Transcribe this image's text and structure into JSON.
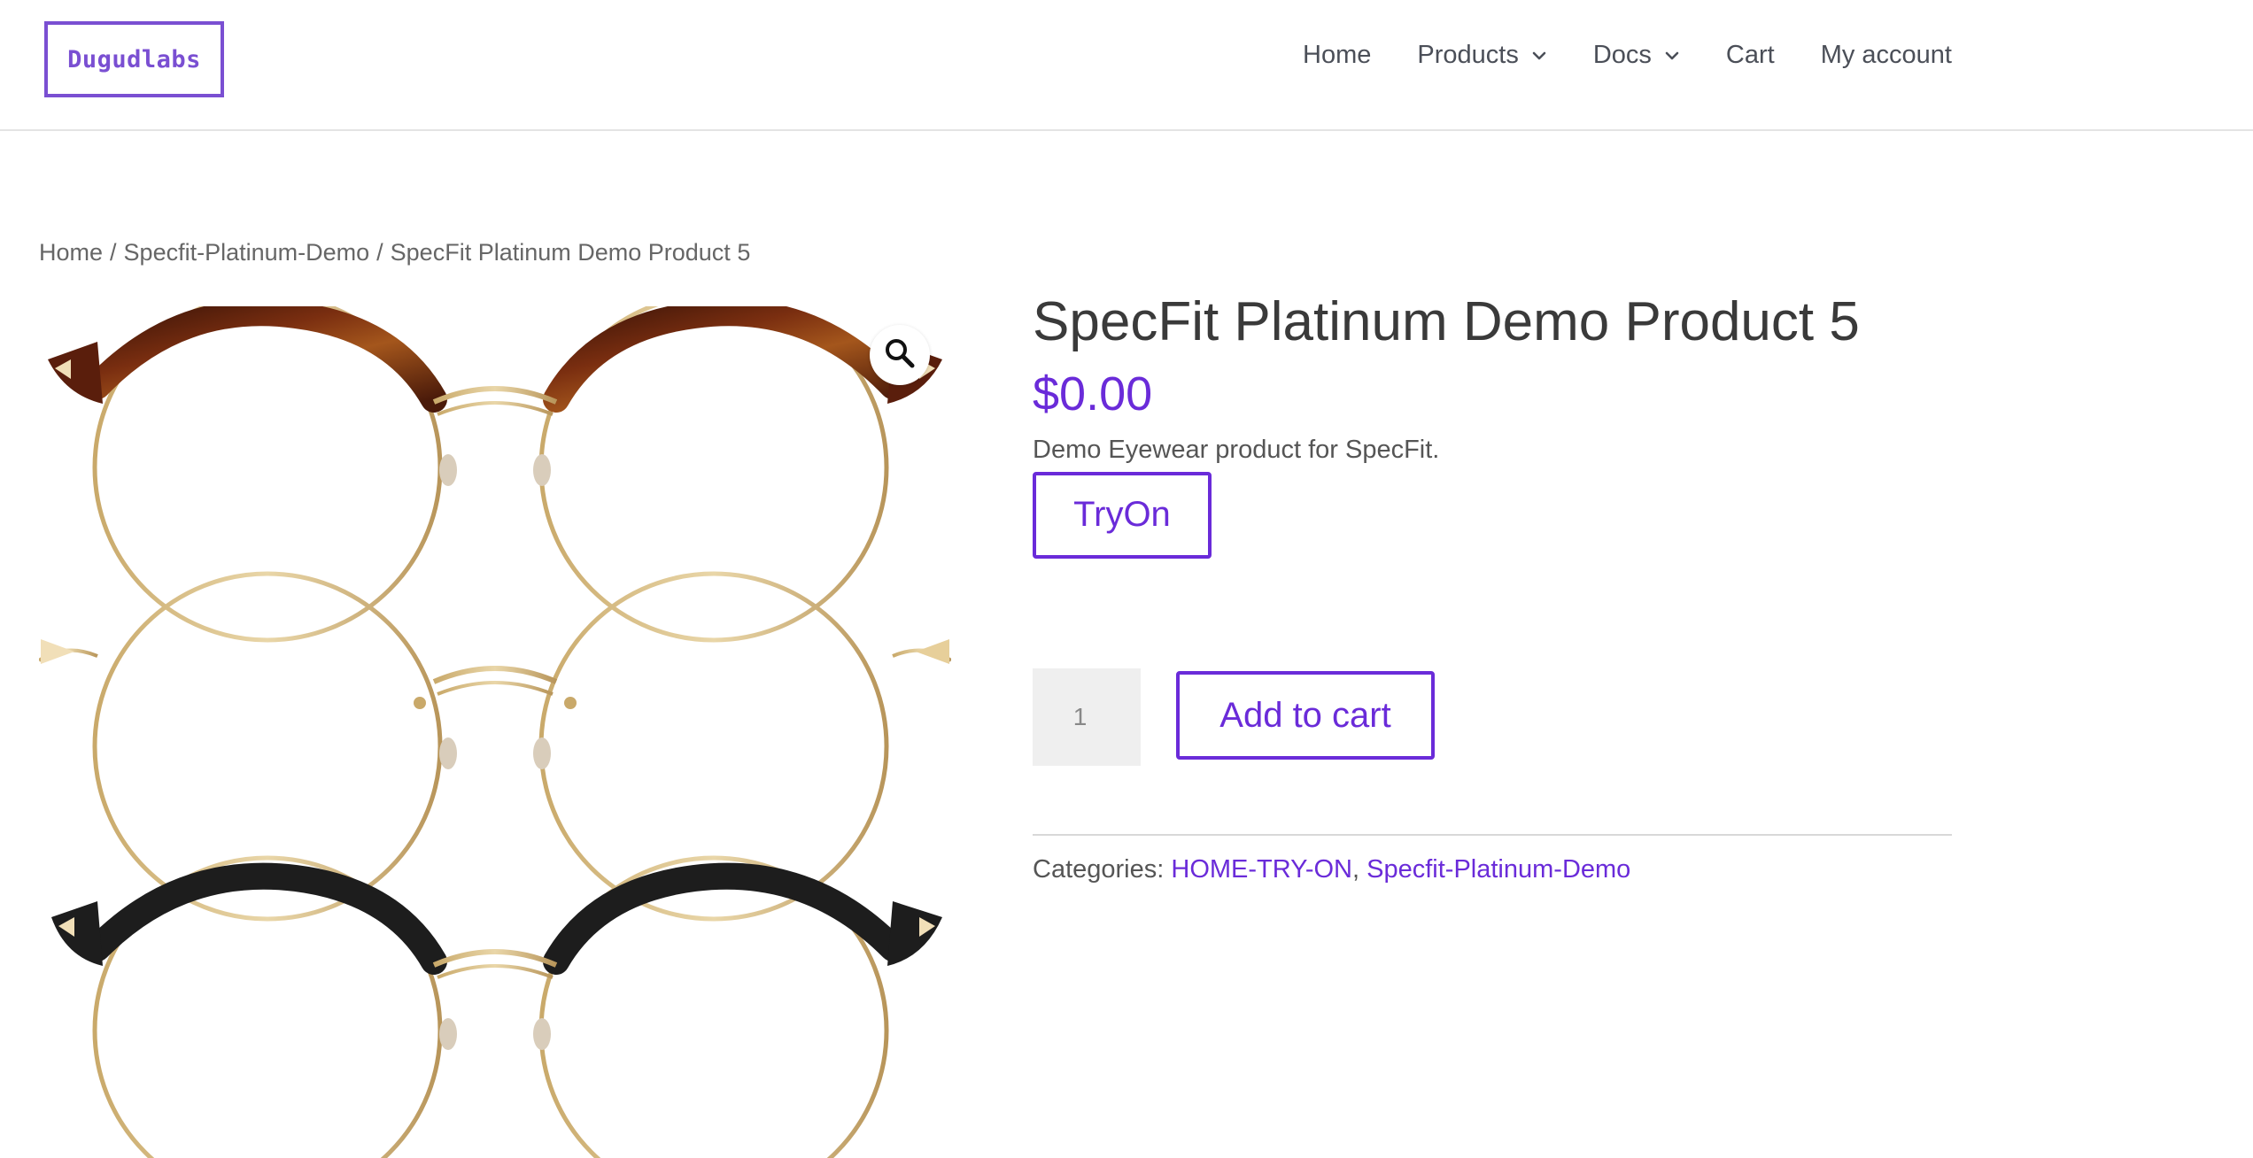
{
  "header": {
    "logo_text": "Dugudlabs",
    "nav": [
      {
        "label": "Home",
        "has_dropdown": false
      },
      {
        "label": "Products",
        "has_dropdown": true
      },
      {
        "label": "Docs",
        "has_dropdown": true
      },
      {
        "label": "Cart",
        "has_dropdown": false
      },
      {
        "label": "My account",
        "has_dropdown": false
      }
    ]
  },
  "breadcrumb": {
    "home": "Home",
    "sep1": "/",
    "category": "Specfit-Platinum-Demo",
    "sep2": "/",
    "current": "SpecFit Platinum Demo Product 5"
  },
  "gallery": {
    "zoom_icon": "magnifier-icon"
  },
  "product": {
    "title": "SpecFit Platinum Demo Product 5",
    "price": "$0.00",
    "description": "Demo Eyewear product for SpecFit.",
    "tryon_label": "TryOn",
    "quantity": "1",
    "add_to_cart_label": "Add to cart",
    "categories_label": "Categories:",
    "categories": [
      "HOME-TRY-ON",
      "Specfit-Platinum-Demo"
    ],
    "category_separator": ","
  },
  "colors": {
    "accent": "#6a2bd9",
    "logo": "#7a4fd2",
    "text": "#3a3a3a"
  }
}
